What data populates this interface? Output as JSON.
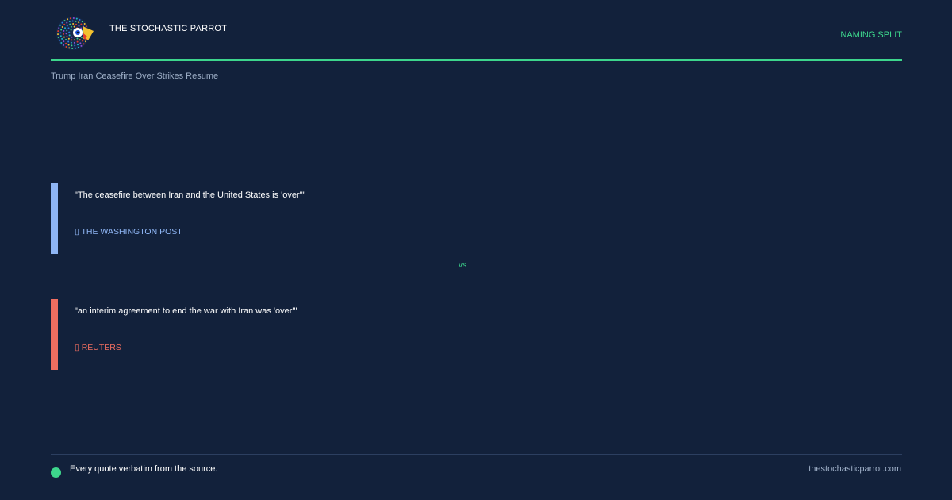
{
  "header": {
    "brand_name": "THE STOCHASTIC PARROT",
    "tag": "NAMING SPLIT",
    "logo_icon": "parrot-logo-icon"
  },
  "story": {
    "title": "Trump Iran Ceasefire Over Strikes Resume"
  },
  "quotes": [
    {
      "text": "\"The ceasefire between Iran and the United States is 'over'\"",
      "source": "▯ THE WASHINGTON POST",
      "color": "#8fb6f5"
    },
    {
      "text": "\"an interim agreement to end the war with Iran was 'over'\"",
      "source": "▯ REUTERS",
      "color": "#f06e60"
    }
  ],
  "separator": "vs",
  "footer": {
    "note": "Every quote verbatim from the source.",
    "site": "thestochasticparrot.com"
  },
  "colors": {
    "background": "#12213b",
    "accent": "#3dd68c",
    "muted_text": "#9fb0c8"
  }
}
